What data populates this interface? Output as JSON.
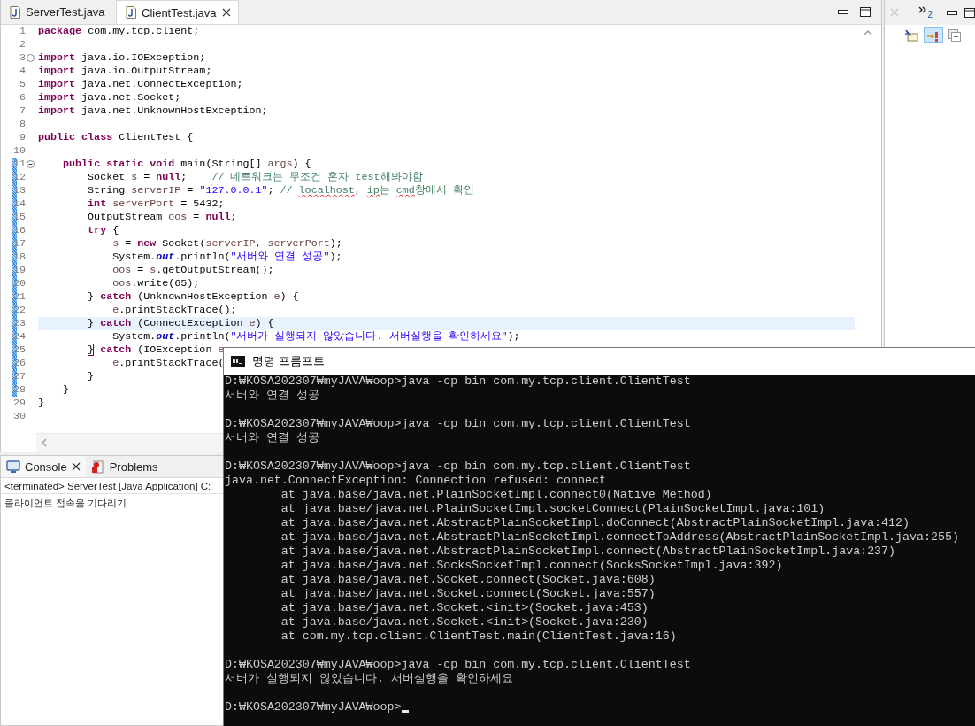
{
  "editor": {
    "tabs": [
      {
        "label": "ServerTest.java",
        "selected": false
      },
      {
        "label": "ClientTest.java",
        "selected": true
      }
    ],
    "lines": [
      {
        "number": "1",
        "changed": false,
        "current": false,
        "fold": false,
        "segments": [
          {
            "kind": "kw",
            "text": "package"
          },
          {
            "kind": "plain",
            "text": " com.my.tcp.client;"
          }
        ]
      },
      {
        "number": "2",
        "changed": false,
        "current": false,
        "fold": false
      },
      {
        "number": "3",
        "changed": false,
        "current": false,
        "fold": true,
        "segments": [
          {
            "kind": "kw",
            "text": "import"
          },
          {
            "kind": "plain",
            "text": " java.io.IOException;"
          }
        ]
      },
      {
        "number": "4",
        "changed": false,
        "current": false,
        "fold": false,
        "segments": [
          {
            "kind": "kw",
            "text": "import"
          },
          {
            "kind": "plain",
            "text": " java.io.OutputStream;"
          }
        ]
      },
      {
        "number": "5",
        "changed": false,
        "current": false,
        "fold": false,
        "segments": [
          {
            "kind": "kw",
            "text": "import"
          },
          {
            "kind": "plain",
            "text": " java.net.ConnectException;"
          }
        ]
      },
      {
        "number": "6",
        "changed": false,
        "current": false,
        "fold": false,
        "segments": [
          {
            "kind": "kw",
            "text": "import"
          },
          {
            "kind": "plain",
            "text": " java.net.Socket;"
          }
        ]
      },
      {
        "number": "7",
        "changed": false,
        "current": false,
        "fold": false,
        "segments": [
          {
            "kind": "kw",
            "text": "import"
          },
          {
            "kind": "plain",
            "text": " java.net.UnknownHostException;"
          }
        ]
      },
      {
        "number": "8",
        "changed": false,
        "current": false,
        "fold": false
      },
      {
        "number": "9",
        "changed": false,
        "current": false,
        "fold": false,
        "segments": [
          {
            "kind": "kw",
            "text": "public class"
          },
          {
            "kind": "plain",
            "text": " ClientTest {"
          }
        ]
      },
      {
        "number": "10",
        "changed": false,
        "current": false,
        "fold": false
      },
      {
        "number": "11",
        "changed": true,
        "current": false,
        "fold": true,
        "segments": [
          {
            "kind": "kw",
            "text": "    public static void"
          },
          {
            "kind": "plain",
            "text": " main(String[] "
          },
          {
            "kind": "var",
            "text": "args"
          },
          {
            "kind": "plain",
            "text": ") {"
          }
        ]
      },
      {
        "number": "12",
        "changed": true,
        "current": false,
        "fold": false,
        "segments": [
          {
            "kind": "plain",
            "text": "        Socket "
          },
          {
            "kind": "var",
            "text": "s"
          },
          {
            "kind": "plain",
            "text": " = "
          },
          {
            "kind": "kw",
            "text": "null"
          },
          {
            "kind": "plain",
            "text": ";    "
          },
          {
            "kind": "comment",
            "text": "// 네트워크는 무조건 혼자 test해봐야함"
          }
        ]
      },
      {
        "number": "13",
        "changed": true,
        "current": false,
        "fold": false,
        "segments": [
          {
            "kind": "plain",
            "text": "        String "
          },
          {
            "kind": "var",
            "text": "serverIP"
          },
          {
            "kind": "plain",
            "text": " = "
          },
          {
            "kind": "str",
            "text": "\"127.0.0.1\""
          },
          {
            "kind": "plain",
            "text": "; "
          },
          {
            "kind": "comment",
            "text": "// "
          },
          {
            "kind": "typo",
            "text": "localhost"
          },
          {
            "kind": "comment",
            "text": ", "
          },
          {
            "kind": "typo",
            "text": "ip"
          },
          {
            "kind": "comment",
            "text": "는 "
          },
          {
            "kind": "typo",
            "text": "cmd"
          },
          {
            "kind": "comment",
            "text": "창에서 확인"
          }
        ]
      },
      {
        "number": "14",
        "changed": true,
        "current": false,
        "fold": false,
        "segments": [
          {
            "kind": "kw",
            "text": "        int"
          },
          {
            "kind": "var",
            "text": " serverPort"
          },
          {
            "kind": "plain",
            "text": " = 5432;"
          }
        ]
      },
      {
        "number": "15",
        "changed": true,
        "current": false,
        "fold": false,
        "segments": [
          {
            "kind": "plain",
            "text": "        OutputStream "
          },
          {
            "kind": "var",
            "text": "oos"
          },
          {
            "kind": "plain",
            "text": " = "
          },
          {
            "kind": "kw",
            "text": "null"
          },
          {
            "kind": "plain",
            "text": ";"
          }
        ]
      },
      {
        "number": "16",
        "changed": true,
        "current": false,
        "fold": false,
        "segments": [
          {
            "kind": "kw",
            "text": "        try"
          },
          {
            "kind": "plain",
            "text": " {"
          }
        ]
      },
      {
        "number": "17",
        "changed": true,
        "current": false,
        "fold": false,
        "segments": [
          {
            "kind": "var",
            "text": "            s"
          },
          {
            "kind": "plain",
            "text": " = "
          },
          {
            "kind": "kw",
            "text": "new"
          },
          {
            "kind": "plain",
            "text": " Socket("
          },
          {
            "kind": "var",
            "text": "serverIP"
          },
          {
            "kind": "plain",
            "text": ", "
          },
          {
            "kind": "var",
            "text": "serverPort"
          },
          {
            "kind": "plain",
            "text": ");"
          }
        ]
      },
      {
        "number": "18",
        "changed": true,
        "current": false,
        "fold": false,
        "segments": [
          {
            "kind": "plain",
            "text": "            System."
          },
          {
            "kind": "field",
            "text": "out"
          },
          {
            "kind": "plain",
            "text": ".println("
          },
          {
            "kind": "str",
            "text": "\"서버와 연결 성공\""
          },
          {
            "kind": "plain",
            "text": ");"
          }
        ]
      },
      {
        "number": "19",
        "changed": true,
        "current": false,
        "fold": false,
        "segments": [
          {
            "kind": "var",
            "text": "            oos"
          },
          {
            "kind": "plain",
            "text": " = "
          },
          {
            "kind": "var",
            "text": "s"
          },
          {
            "kind": "plain",
            "text": ".getOutputStream();"
          }
        ]
      },
      {
        "number": "20",
        "changed": true,
        "current": false,
        "fold": false,
        "segments": [
          {
            "kind": "var",
            "text": "            oos"
          },
          {
            "kind": "plain",
            "text": ".write(65);"
          }
        ]
      },
      {
        "number": "21",
        "changed": true,
        "current": false,
        "fold": false,
        "segments": [
          {
            "kind": "plain",
            "text": "        } "
          },
          {
            "kind": "kw",
            "text": "catch"
          },
          {
            "kind": "plain",
            "text": " (UnknownHostException "
          },
          {
            "kind": "var",
            "text": "e"
          },
          {
            "kind": "plain",
            "text": ") {"
          }
        ]
      },
      {
        "number": "22",
        "changed": true,
        "current": false,
        "fold": false,
        "segments": [
          {
            "kind": "var",
            "text": "            e"
          },
          {
            "kind": "plain",
            "text": ".printStackTrace();"
          }
        ]
      },
      {
        "number": "23",
        "changed": true,
        "current": true,
        "fold": false,
        "segments": [
          {
            "kind": "plain",
            "text": "        } "
          },
          {
            "kind": "kw",
            "text": "catch"
          },
          {
            "kind": "plain",
            "text": " (ConnectException "
          },
          {
            "kind": "var",
            "text": "e"
          },
          {
            "kind": "plain",
            "text": ") {"
          }
        ]
      },
      {
        "number": "24",
        "changed": true,
        "current": false,
        "fold": false,
        "segments": [
          {
            "kind": "plain",
            "text": "            System."
          },
          {
            "kind": "field",
            "text": "out"
          },
          {
            "kind": "plain",
            "text": ".println("
          },
          {
            "kind": "str",
            "text": "\"서버가 실행되지 않았습니다. 서버실행을 확인하세요\""
          },
          {
            "kind": "plain",
            "text": ");"
          }
        ]
      },
      {
        "number": "25",
        "changed": true,
        "current": false,
        "fold": false,
        "segments": [
          {
            "kind": "bracket",
            "text": "        }"
          },
          {
            "kind": "kw",
            "text": " catch"
          },
          {
            "kind": "plain",
            "text": " (IOException "
          },
          {
            "kind": "var",
            "text": "e"
          }
        ]
      },
      {
        "number": "26",
        "changed": true,
        "current": false,
        "fold": false,
        "segments": [
          {
            "kind": "var",
            "text": "            e"
          },
          {
            "kind": "plain",
            "text": ".printStackTrace("
          }
        ]
      },
      {
        "number": "27",
        "changed": true,
        "current": false,
        "fold": false,
        "segments": [
          {
            "kind": "plain",
            "text": "        }"
          }
        ]
      },
      {
        "number": "28",
        "changed": true,
        "current": false,
        "fold": false,
        "segments": [
          {
            "kind": "plain",
            "text": "    }"
          }
        ]
      },
      {
        "number": "29",
        "changed": false,
        "current": false,
        "fold": false,
        "segments": [
          {
            "kind": "plain",
            "text": "}"
          }
        ]
      },
      {
        "number": "30",
        "changed": false,
        "current": false,
        "fold": false
      }
    ]
  },
  "side_panel": {
    "overflow_count": "2"
  },
  "console": {
    "tabs": [
      {
        "label": "Console",
        "selected": true,
        "kind": "console"
      },
      {
        "label": "Problems",
        "selected": false,
        "kind": "problems"
      }
    ],
    "status": "<terminated> ServerTest [Java Application] C:",
    "output": "클라이언트 접속을 기다리기"
  },
  "terminal": {
    "title": "명령 프롬프트",
    "blocks": [
      [
        "D:₩KOSA202307₩myJAVA₩oop>java -cp bin com.my.tcp.client.ClientTest",
        "서버와 연결 성공"
      ],
      [
        "D:₩KOSA202307₩myJAVA₩oop>java -cp bin com.my.tcp.client.ClientTest",
        "서버와 연결 성공"
      ],
      [
        "D:₩KOSA202307₩myJAVA₩oop>java -cp bin com.my.tcp.client.ClientTest",
        "java.net.ConnectException: Connection refused: connect",
        "\tat java.base/java.net.PlainSocketImpl.connect0(Native Method)",
        "\tat java.base/java.net.PlainSocketImpl.socketConnect(PlainSocketImpl.java:101)",
        "\tat java.base/java.net.AbstractPlainSocketImpl.doConnect(AbstractPlainSocketImpl.java:412)",
        "\tat java.base/java.net.AbstractPlainSocketImpl.connectToAddress(AbstractPlainSocketImpl.java:255)",
        "\tat java.base/java.net.AbstractPlainSocketImpl.connect(AbstractPlainSocketImpl.java:237)",
        "\tat java.base/java.net.SocksSocketImpl.connect(SocksSocketImpl.java:392)",
        "\tat java.base/java.net.Socket.connect(Socket.java:608)",
        "\tat java.base/java.net.Socket.connect(Socket.java:557)",
        "\tat java.base/java.net.Socket.<init>(Socket.java:453)",
        "\tat java.base/java.net.Socket.<init>(Socket.java:230)",
        "\tat com.my.tcp.client.ClientTest.main(ClientTest.java:16)"
      ],
      [
        "D:₩KOSA202307₩myJAVA₩oop>java -cp bin com.my.tcp.client.ClientTest",
        "서버가 실행되지 않았습니다. 서버실행을 확인하세요"
      ]
    ],
    "prompt": "D:₩KOSA202307₩myJAVA₩oop>",
    "cursor": true
  }
}
